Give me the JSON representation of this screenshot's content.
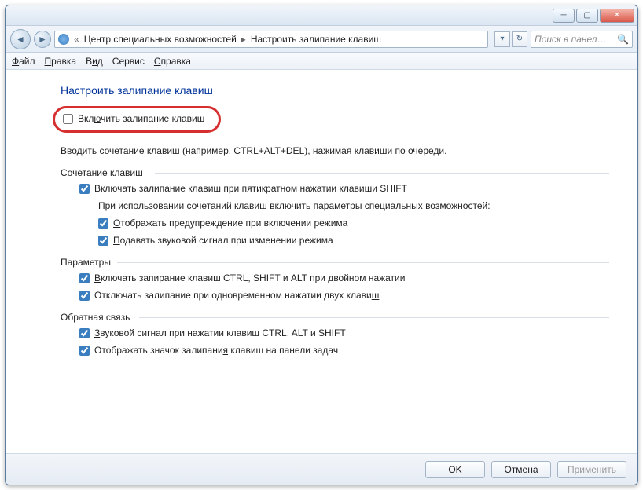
{
  "titlebar": {},
  "breadcrumb": {
    "root": "Центр специальных возможностей",
    "current": "Настроить залипание клавиш"
  },
  "search": {
    "placeholder": "Поиск в панел…"
  },
  "menu": {
    "file": "Файл",
    "edit": "Правка",
    "view": "Вид",
    "tools": "Сервис",
    "help": "Справка"
  },
  "heading": "Настроить залипание клавиш",
  "main_checkbox": "Включить залипание клавиш",
  "description": "Вводить сочетание клавиш (например, CTRL+ALT+DEL), нажимая клавиши по очереди.",
  "group1": {
    "title": "Сочетание клавиш",
    "cb1": "Включать залипание клавиш при пятикратном нажатии клавиши SHIFT",
    "sub_caption": "При использовании сочетаний клавиш включить параметры специальных возможностей:",
    "cb2": "Отображать предупреждение при включении режима",
    "cb3": "Подавать звуковой сигнал при изменении режима"
  },
  "group2": {
    "title": "Параметры",
    "cb1": "Включать запирание клавиш CTRL, SHIFT и ALT при двойном нажатии",
    "cb2": "Отключать залипание при одновременном нажатии двух клавиш"
  },
  "group3": {
    "title": "Обратная связь",
    "cb1": "Звуковой сигнал при нажатии клавиш CTRL, ALT и SHIFT",
    "cb2": "Отображать значок залипания клавиш на панели задач"
  },
  "buttons": {
    "ok": "OK",
    "cancel": "Отмена",
    "apply": "Применить"
  }
}
